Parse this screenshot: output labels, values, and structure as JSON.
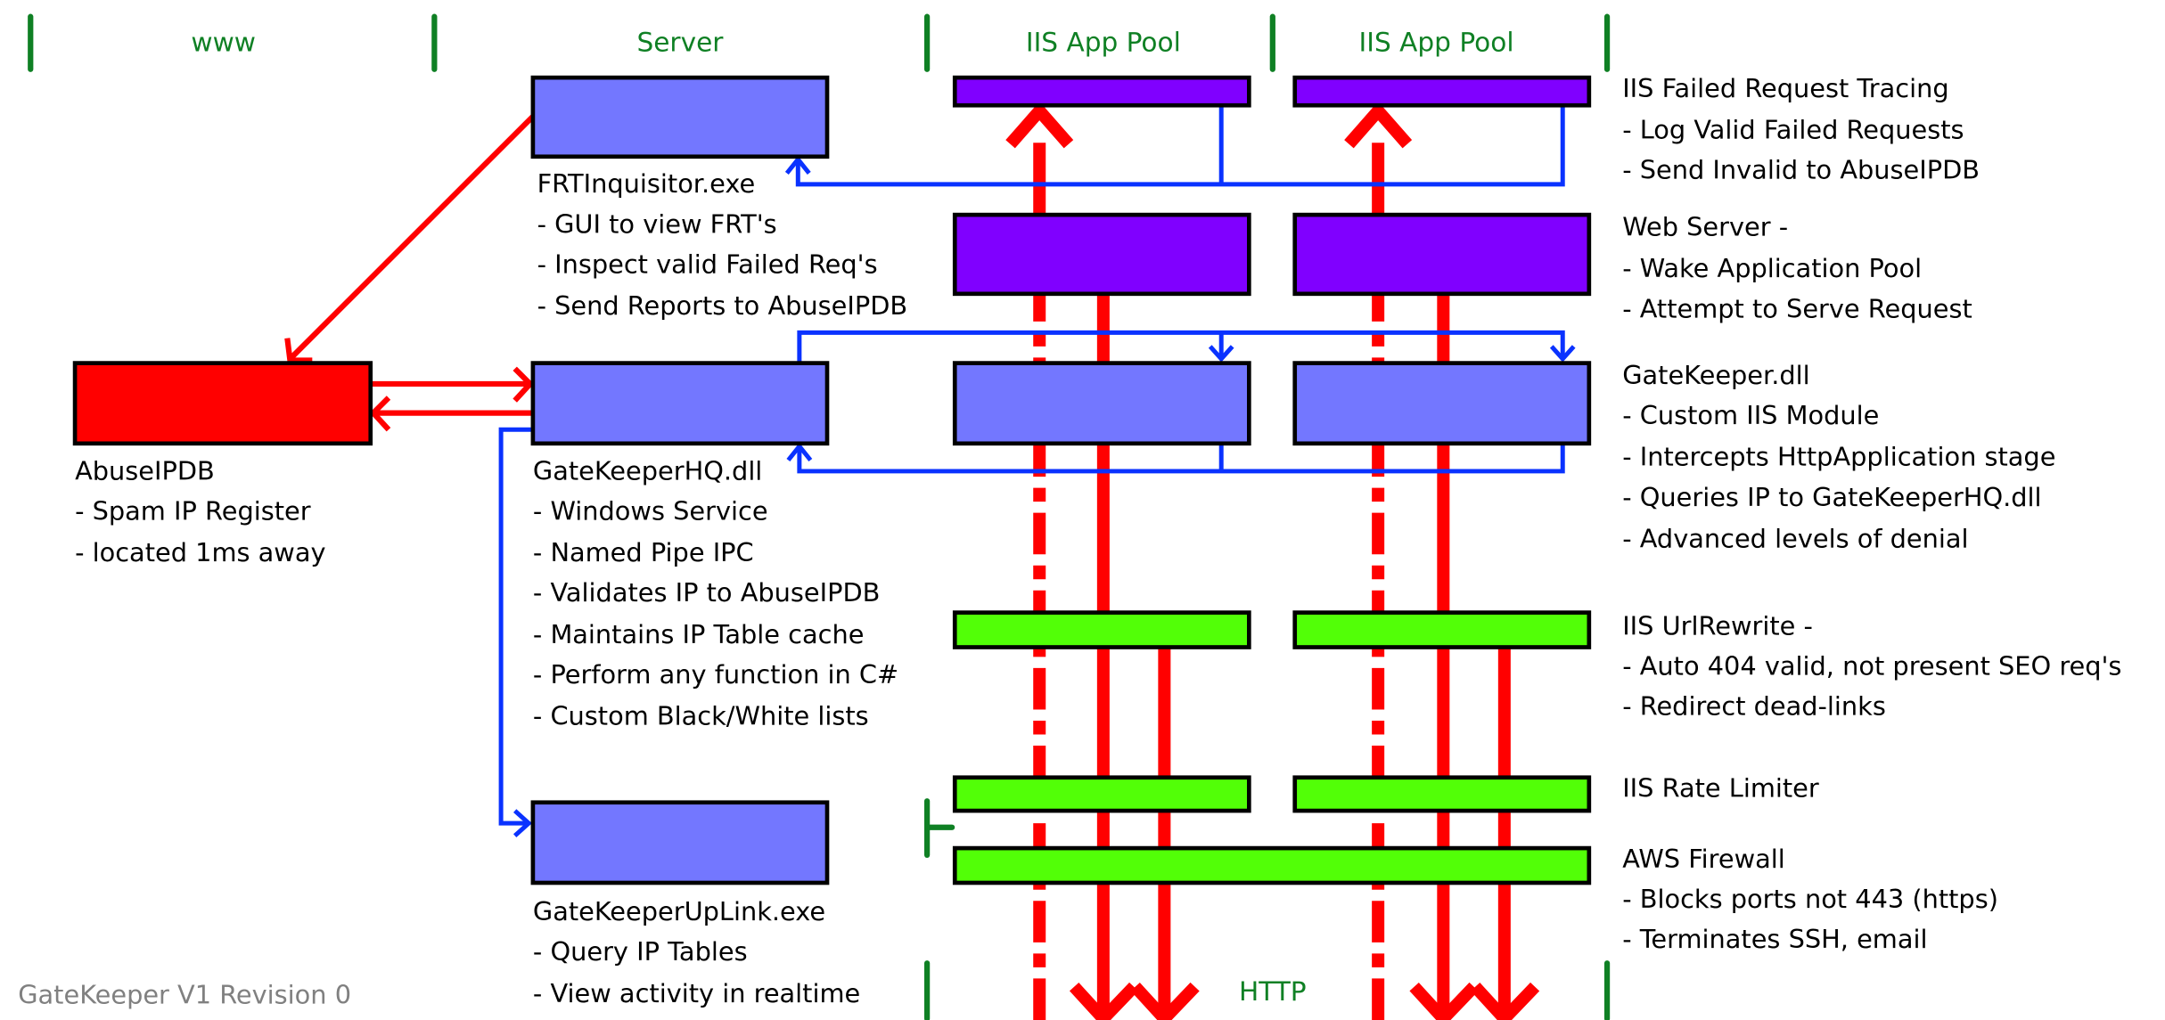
{
  "columns": {
    "www": "www",
    "server": "Server",
    "app_pool_1": "IIS App Pool",
    "app_pool_2": "IIS App Pool",
    "http": "HTTP"
  },
  "components": {
    "frt_inquisitor": {
      "title": "FRTInquisitor.exe",
      "lines": [
        "- GUI to view FRT's",
        "- Inspect valid Failed Req's",
        "- Send Reports to AbuseIPDB"
      ]
    },
    "abuseipdb": {
      "title": "AbuseIPDB",
      "lines": [
        "- Spam IP Register",
        "- located 1ms away"
      ]
    },
    "gatekeeper_hq": {
      "title": "GateKeeperHQ.dll",
      "lines": [
        "- Windows Service",
        "- Named Pipe IPC",
        "- Validates IP to AbuseIPDB",
        "- Maintains IP Table cache",
        "- Perform any function in C#",
        "- Custom Black/White lists"
      ]
    },
    "gatekeeper_uplink": {
      "title": "GateKeeperUpLink.exe",
      "lines": [
        "- Query IP Tables",
        "- View activity in realtime"
      ]
    }
  },
  "layers": {
    "failed_request_tracing": {
      "title": "IIS Failed Request Tracing",
      "lines": [
        "- Log Valid Failed Requests",
        "- Send Invalid to AbuseIPDB"
      ]
    },
    "web_server": {
      "title": "Web Server -",
      "lines": [
        "- Wake Application Pool",
        "- Attempt to Serve Request"
      ]
    },
    "gatekeeper_dll": {
      "title": "GateKeeper.dll",
      "lines": [
        "- Custom IIS Module",
        "- Intercepts HttpApplication stage",
        "- Queries IP to GateKeeperHQ.dll",
        "- Advanced levels of denial"
      ]
    },
    "url_rewrite": {
      "title": "IIS UrlRewrite -",
      "lines": [
        "- Auto 404 valid, not present SEO req's",
        "- Redirect dead-links"
      ]
    },
    "rate_limiter": {
      "title": "IIS Rate Limiter",
      "lines": []
    },
    "aws_firewall": {
      "title": "AWS Firewall",
      "lines": [
        "- Blocks ports not 443 (https)",
        "- Terminates SSH, email"
      ]
    }
  },
  "footer": "GateKeeper V1 Revision 0",
  "colors": {
    "component": "#7377ff",
    "iis_core": "#8000ff",
    "filter": "#52ff07",
    "external": "#ff0000",
    "ipc_link": "#0a32ff",
    "request_flow": "#ff0000",
    "zone_divider": "#0f8024"
  }
}
